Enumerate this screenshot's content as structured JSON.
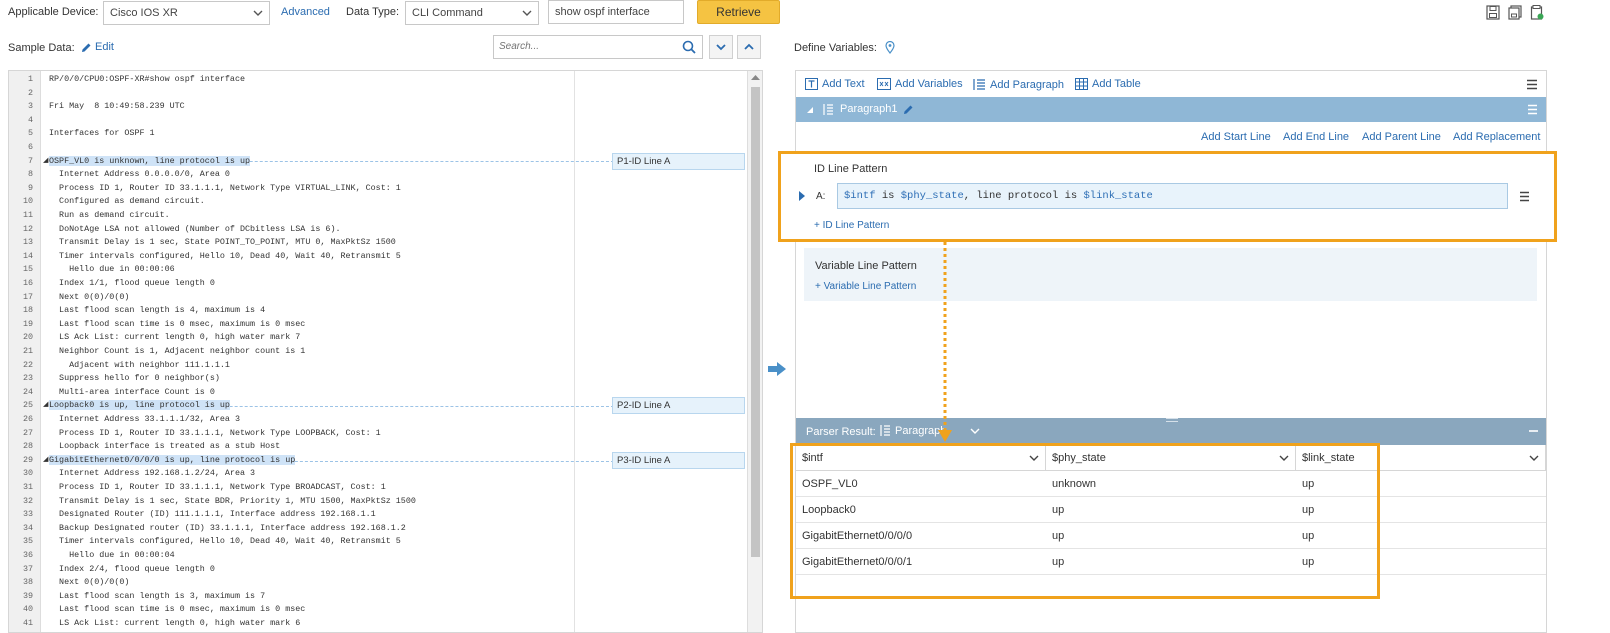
{
  "top": {
    "applicable_device_label": "Applicable Device:",
    "device_value": "Cisco IOS XR",
    "advanced_label": "Advanced",
    "data_type_label": "Data Type:",
    "data_type_value": "CLI Command",
    "command_value": "show ospf interface",
    "retrieve_label": "Retrieve",
    "icons": [
      "save-icon",
      "save-all-icon",
      "export-icon"
    ]
  },
  "sample": {
    "label": "Sample Data:",
    "edit_label": "Edit",
    "search_placeholder": "Search..."
  },
  "code_lines": [
    "RP/0/0/CPU0:OSPF-XR#show ospf interface",
    "",
    "Fri May  8 10:49:58.239 UTC",
    "",
    "Interfaces for OSPF 1",
    "",
    "OSPF_VL0 is unknown, line protocol is up",
    "  Internet Address 0.0.0.0/0, Area 0",
    "  Process ID 1, Router ID 33.1.1.1, Network Type VIRTUAL_LINK, Cost: 1",
    "  Configured as demand circuit.",
    "  Run as demand circuit.",
    "  DoNotAge LSA not allowed (Number of DCbitless LSA is 6).",
    "  Transmit Delay is 1 sec, State POINT_TO_POINT, MTU 0, MaxPktSz 1500",
    "  Timer intervals configured, Hello 10, Dead 40, Wait 40, Retransmit 5",
    "    Hello due in 00:00:06",
    "  Index 1/1, flood queue length 0",
    "  Next 0(0)/0(0)",
    "  Last flood scan length is 4, maximum is 4",
    "  Last flood scan time is 0 msec, maximum is 0 msec",
    "  LS Ack List: current length 0, high water mark 7",
    "  Neighbor Count is 1, Adjacent neighbor count is 1",
    "    Adjacent with neighbor 111.1.1.1",
    "  Suppress hello for 0 neighbor(s)",
    "  Multi-area interface Count is 0",
    "Loopback0 is up, line protocol is up",
    "  Internet Address 33.1.1.1/32, Area 3",
    "  Process ID 1, Router ID 33.1.1.1, Network Type LOOPBACK, Cost: 1",
    "  Loopback interface is treated as a stub Host",
    "GigabitEthernet0/0/0/0 is up, line protocol is up",
    "  Internet Address 192.168.1.2/24, Area 3",
    "  Process ID 1, Router ID 33.1.1.1, Network Type BROADCAST, Cost: 1",
    "  Transmit Delay is 1 sec, State BDR, Priority 1, MTU 1500, MaxPktSz 1500",
    "  Designated Router (ID) 111.1.1.1, Interface address 192.168.1.1",
    "  Backup Designated router (ID) 33.1.1.1, Interface address 192.168.1.2",
    "  Timer intervals configured, Hello 10, Dead 40, Wait 40, Retransmit 5",
    "    Hello due in 00:00:04",
    "  Index 2/4, flood queue length 0",
    "  Next 0(0)/0(0)",
    "  Last flood scan length is 3, maximum is 7",
    "  Last flood scan time is 0 msec, maximum is 0 msec",
    "  LS Ack List: current length 0, high water mark 6"
  ],
  "highlighted_lines": [
    7,
    25,
    29
  ],
  "markers": [
    "P1-ID Line A",
    "P2-ID Line A",
    "P3-ID Line A"
  ],
  "define": {
    "label": "Define Variables:",
    "toolbar": [
      "Add Text",
      "Add Variables",
      "Add Paragraph",
      "Add Table"
    ],
    "paragraph_title": "Paragraph1",
    "add_links": [
      "Add Start Line",
      "Add End Line",
      "Add Parent Line",
      "Add Replacement"
    ],
    "id_line_pattern_label": "ID Line Pattern",
    "pattern_prefix": "A:",
    "pattern": [
      {
        "t": "$intf",
        "v": true
      },
      {
        "t": " is ",
        "v": false
      },
      {
        "t": "$phy_state",
        "v": true
      },
      {
        "t": ", line protocol is ",
        "v": false
      },
      {
        "t": "$link_state",
        "v": true
      }
    ],
    "add_id_line_pattern": "+ ID Line Pattern",
    "variable_line_pattern_label": "Variable Line Pattern",
    "add_variable_line_pattern": "+ Variable Line Pattern"
  },
  "result": {
    "label": "Parser Result:",
    "paragraph_select": "Paragraph",
    "columns": [
      "$intf",
      "$phy_state",
      "$link_state"
    ],
    "rows": [
      [
        "OSPF_VL0",
        "unknown",
        "up"
      ],
      [
        "Loopback0",
        "up",
        "up"
      ],
      [
        "GigabitEthernet0/0/0/0",
        "up",
        "up"
      ],
      [
        "GigabitEthernet0/0/0/1",
        "up",
        "up"
      ]
    ]
  },
  "colors": {
    "accent": "#2b6cb0",
    "highlight_orange": "#f0a21c",
    "paragraph_bar": "#8fb7d6",
    "result_bar": "#8aa7be",
    "retrieve": "#f5c342"
  }
}
